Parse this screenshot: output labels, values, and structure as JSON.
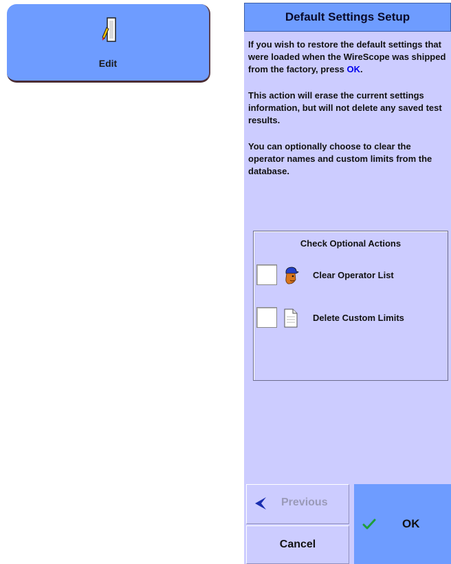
{
  "edit_button": {
    "label": "Edit",
    "icon": "edit-document-icon"
  },
  "dialog": {
    "title": "Default Settings Setup",
    "paragraph_1_text": "If you wish to restore the default settings that were loaded when the WireScope was shipped from the factory, press ",
    "paragraph_1_ok": "OK",
    "paragraph_1_end": ".",
    "paragraph_2": "This action will erase the current settings information, but will not delete any saved test results.",
    "paragraph_3": "You can optionally choose to clear the operator names and custom limits from the database.",
    "options": {
      "title": "Check Optional Actions",
      "items": [
        {
          "label": "Clear Operator List",
          "checked": false,
          "icon": "operator-person-icon"
        },
        {
          "label": "Delete Custom Limits",
          "checked": false,
          "icon": "document-icon"
        }
      ]
    }
  },
  "buttons": {
    "previous": {
      "label": "Previous",
      "enabled": false,
      "icon": "left-arrow-icon"
    },
    "cancel": {
      "label": "Cancel"
    },
    "ok": {
      "label": "OK",
      "icon": "checkmark-icon"
    }
  },
  "colors": {
    "button_blue": "#6e9cff",
    "panel_lavender": "#ccccff",
    "link_blue": "#0000ee",
    "disabled_text": "#9a9ab8",
    "check_green": "#1f9e3a"
  }
}
